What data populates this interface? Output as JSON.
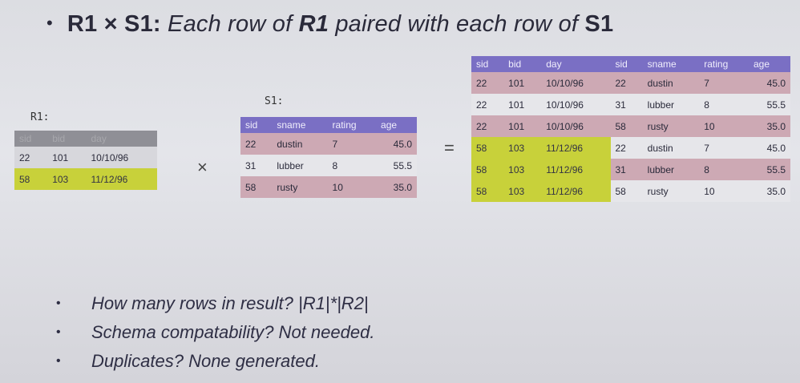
{
  "title": {
    "bullet": "•",
    "part1": "R1 × S1:",
    "part2": " Each row of ",
    "part3": "R1",
    "part4": " paired with each row of ",
    "part5": "S1"
  },
  "r1": {
    "label": "R1:",
    "headers": [
      "sid",
      "bid",
      "day"
    ],
    "rows": [
      [
        "22",
        "101",
        "10/10/96"
      ],
      [
        "58",
        "103",
        "11/12/96"
      ]
    ]
  },
  "s1": {
    "label": "S1:",
    "headers": [
      "sid",
      "sname",
      "rating",
      "age"
    ],
    "rows": [
      [
        "22",
        "dustin",
        "7",
        "45.0"
      ],
      [
        "31",
        "lubber",
        "8",
        "55.5"
      ],
      [
        "58",
        "rusty",
        "10",
        "35.0"
      ]
    ]
  },
  "ops": {
    "times": "×",
    "equals": "="
  },
  "result": {
    "headers": [
      "sid",
      "bid",
      "day",
      "sid",
      "sname",
      "rating",
      "age"
    ],
    "rows": [
      [
        "22",
        "101",
        "10/10/96",
        "22",
        "dustin",
        "7",
        "45.0"
      ],
      [
        "22",
        "101",
        "10/10/96",
        "31",
        "lubber",
        "8",
        "55.5"
      ],
      [
        "22",
        "101",
        "10/10/96",
        "58",
        "rusty",
        "10",
        "35.0"
      ],
      [
        "58",
        "103",
        "11/12/96",
        "22",
        "dustin",
        "7",
        "45.0"
      ],
      [
        "58",
        "103",
        "11/12/96",
        "31",
        "lubber",
        "8",
        "55.5"
      ],
      [
        "58",
        "103",
        "11/12/96",
        "58",
        "rusty",
        "10",
        "35.0"
      ]
    ]
  },
  "bullets": [
    "How many rows in result?  |R1|*|R2|",
    "Schema compatability?  Not needed.",
    "Duplicates?  None generated."
  ],
  "colors": {
    "header": "#7a6fc4",
    "highlight": "#c8d13a",
    "pink_row": "#cda9b4"
  }
}
